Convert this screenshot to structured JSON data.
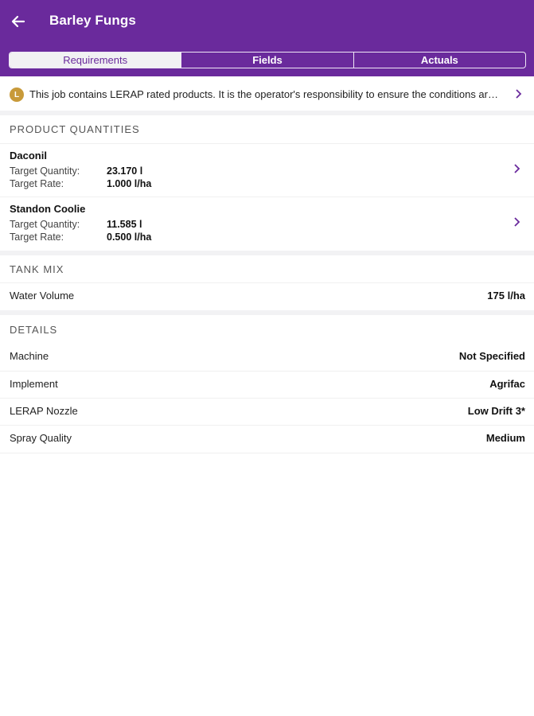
{
  "header": {
    "title": "Barley Fungs",
    "back_icon": "arrow-left-icon",
    "color": "#6a2a9c"
  },
  "tabs": [
    {
      "label": "Requirements",
      "active": true
    },
    {
      "label": "Fields",
      "active": false
    },
    {
      "label": "Actuals",
      "active": false
    }
  ],
  "banner": {
    "badge": "L",
    "text": "This job contains LERAP rated products. It is the operator's responsibility to ensure the conditions are met.",
    "badge_color": "#c89a3a"
  },
  "product_quantities": {
    "header": "PRODUCT QUANTITIES",
    "target_quantity_label": "Target Quantity:",
    "target_rate_label": "Target Rate:",
    "products": [
      {
        "name": "Daconil",
        "target_quantity": "23.170 l",
        "target_rate": "1.000 l/ha"
      },
      {
        "name": "Standon Coolie",
        "target_quantity": "11.585 l",
        "target_rate": "0.500 l/ha"
      }
    ]
  },
  "tank_mix": {
    "header": "TANK MIX",
    "rows": [
      {
        "label": "Water Volume",
        "value": "175 l/ha"
      }
    ]
  },
  "details": {
    "header": "DETAILS",
    "rows": [
      {
        "label": "Machine",
        "value": "Not Specified"
      },
      {
        "label": "Implement",
        "value": "Agrifac"
      },
      {
        "label": "LERAP Nozzle",
        "value": "Low Drift 3*"
      },
      {
        "label": "Spray Quality",
        "value": "Medium"
      }
    ]
  }
}
